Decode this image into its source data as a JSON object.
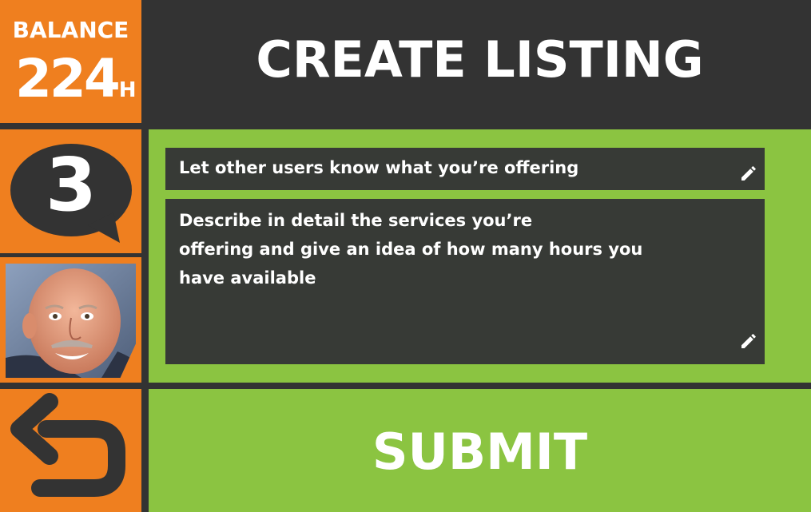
{
  "balance": {
    "label": "BALANCE",
    "value": "224",
    "unit": "H"
  },
  "notifications": {
    "count": "3",
    "icon": "speech-bubble-icon"
  },
  "profile": {
    "avatar_icon": "user-avatar"
  },
  "navigation": {
    "back_icon": "back-arrow-icon"
  },
  "header": {
    "title": "CREATE LISTING"
  },
  "form": {
    "title_field": {
      "value": "Let other users know what you’re offering",
      "icon": "pencil-icon"
    },
    "description_field": {
      "lines": [
        "Describe in detail the services you’re",
        "offering and give an idea of how many hours you",
        "have available"
      ],
      "icon": "pencil-icon"
    }
  },
  "submit": {
    "label": "SUBMIT"
  },
  "colors": {
    "accent_orange": "#ef7f1f",
    "accent_green": "#8bc441",
    "dark_background": "#333333",
    "field_background": "#373a36",
    "text_white": "#ffffff"
  }
}
